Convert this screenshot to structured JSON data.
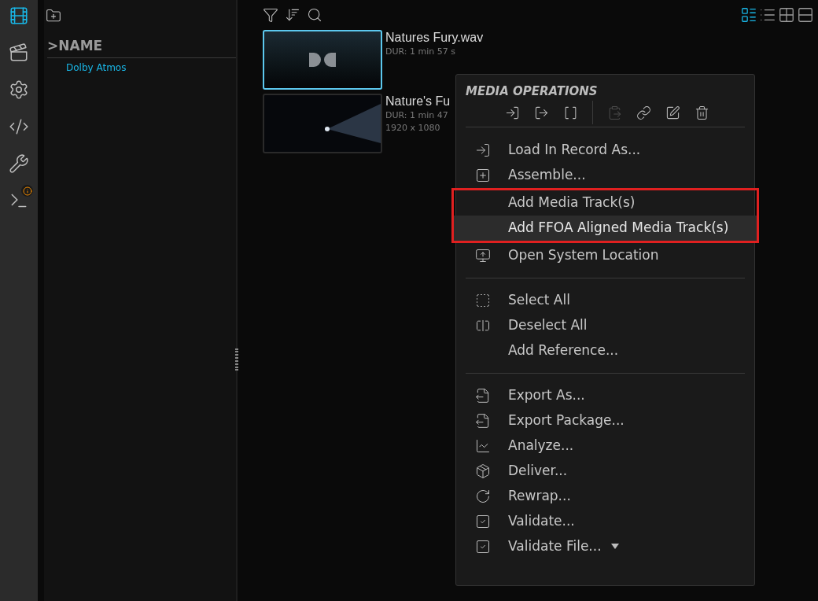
{
  "rail": [
    {
      "selected": true,
      "badge": false
    },
    {
      "selected": false,
      "badge": false
    },
    {
      "selected": false,
      "badge": false
    },
    {
      "selected": false,
      "badge": false
    },
    {
      "selected": false,
      "badge": false
    },
    {
      "selected": false,
      "badge": true
    }
  ],
  "tree": {
    "header": ">NAME",
    "items": [
      {
        "label": "Dolby Atmos",
        "selected": true
      }
    ]
  },
  "view_modes": [
    {
      "selected": true
    },
    {
      "selected": false
    },
    {
      "selected": false
    },
    {
      "selected": false
    }
  ],
  "media": [
    {
      "title": "Natures Fury.wav",
      "duration": "DUR: 1 min 57 s",
      "selected": true,
      "kind": "audio"
    },
    {
      "title": "Nature's Fu",
      "duration": "DUR: 1 min 47",
      "resolution": "1920 x 1080",
      "selected": false,
      "kind": "video"
    }
  ],
  "menu": {
    "title": "MEDIA OPERATIONS",
    "toolbar": [
      {
        "disabled": false
      },
      {
        "disabled": false
      },
      {
        "disabled": false
      },
      {
        "disabled": true
      },
      {
        "disabled": false
      },
      {
        "disabled": false
      },
      {
        "disabled": false
      }
    ],
    "sections": [
      [
        {
          "label": "Load In Record As...",
          "hovered": false,
          "framed": false
        },
        {
          "label": "Assemble...",
          "hovered": false,
          "framed": false
        },
        {
          "label": "Add Media Track(s)",
          "hovered": false,
          "framed": true
        },
        {
          "label": "Add FFOA Aligned Media Track(s)",
          "hovered": true,
          "framed": true
        },
        {
          "label": "Open System Location",
          "hovered": false,
          "framed": false
        }
      ],
      [
        {
          "label": "Select All",
          "hovered": false,
          "framed": false
        },
        {
          "label": "Deselect All",
          "hovered": false,
          "framed": false
        },
        {
          "label": "Add Reference...",
          "hovered": false,
          "framed": false
        }
      ],
      [
        {
          "label": "Export As...",
          "hovered": false,
          "framed": false
        },
        {
          "label": "Export Package...",
          "hovered": false,
          "framed": false
        },
        {
          "label": "Analyze...",
          "hovered": false,
          "framed": false
        },
        {
          "label": "Deliver...",
          "hovered": false,
          "framed": false
        },
        {
          "label": "Rewrap...",
          "hovered": false,
          "framed": false
        },
        {
          "label": "Validate...",
          "hovered": false,
          "framed": false
        },
        {
          "label": "Validate File...",
          "hovered": false,
          "framed": false,
          "submenu": true
        }
      ]
    ]
  }
}
